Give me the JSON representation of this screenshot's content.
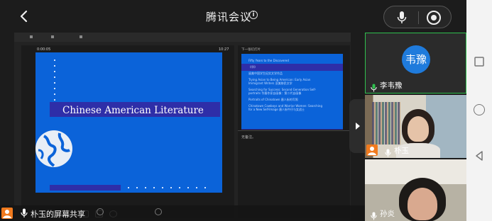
{
  "meeting": {
    "title": "腾讯会议",
    "info_icon": "ⓘ"
  },
  "colors": {
    "background": "#1c1c1c",
    "slide_blue": "#0b63d9",
    "active_speaker_border": "#2fbf4e",
    "avatar_blue": "#1f7bdc",
    "avatar_orange": "#f07a1e"
  },
  "shared_screen": {
    "sharer_label": "朴玉的屏幕共享",
    "presenter": {
      "timer": "0:00:05",
      "clock": "10:27",
      "next_label": "下一张幻灯片",
      "notes_label": "无备注。",
      "current_slide": {
        "title": "Chinese American Literature"
      },
      "next_slide": {
        "lines": [
          "Fifty Years to the Discovered",
          "《华》",
          "留美中国学生纪实文学作品",
          "Trying Asian to Being American: Early Asian",
          "Immigrant Writers 亚美移民文学",
          "Searching for Success: Second Generation Self-",
          "portraits 华裔作家自画像：第二代自画像",
          "Portraits of Chinatown 唐人街的写照",
          "Chinatown Cowboys and Warrior Women: Searching",
          "for a New Self-Image 唐人街牛仔与女战士"
        ]
      }
    }
  },
  "participants": [
    {
      "name": "李韦豫",
      "avatar_text": "韦豫",
      "type": "avatar",
      "speaking": true
    },
    {
      "name": "朴玉",
      "type": "video"
    },
    {
      "name": "孙炎",
      "type": "video"
    }
  ],
  "icons": {
    "back": "chevron-left-icon",
    "mic": "microphone-icon",
    "record": "record-icon",
    "info": "info-icon",
    "collapse": "play-arrow-icon",
    "globe": "globe-icon"
  }
}
